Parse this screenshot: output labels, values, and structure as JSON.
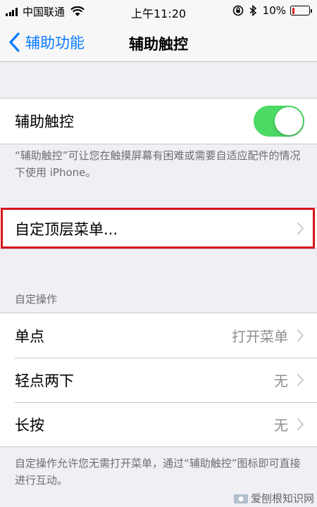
{
  "status_bar": {
    "carrier": "中国联通",
    "time": "上午11:20",
    "battery_percent": "10%",
    "battery_color": "#e02020"
  },
  "nav": {
    "back_label": "辅助功能",
    "title": "辅助触控"
  },
  "toggle_cell": {
    "label": "辅助触控",
    "state": true,
    "color": "#4cd964"
  },
  "toggle_footnote": "“辅助触控”可让您在触摸屏幕有困难或需要自适应配件的情况下使用 iPhone。",
  "customize_cell": {
    "label": "自定顶层菜单..."
  },
  "custom_actions": {
    "header": "自定操作",
    "items": [
      {
        "label": "单点",
        "value": "打开菜单"
      },
      {
        "label": "轻点两下",
        "value": "无"
      },
      {
        "label": "长按",
        "value": "无"
      }
    ],
    "footnote": "自定操作允许您无需打开菜单，通过“辅助触控”图标即可直接进行互动。"
  },
  "highlight_color": "#d6141b",
  "watermark": "爱刨根知识网",
  "icons": [
    "signal-icon",
    "wifi-icon",
    "orientation-lock-icon",
    "bluetooth-icon",
    "battery-icon",
    "chevron-left-icon",
    "chevron-right-icon"
  ]
}
